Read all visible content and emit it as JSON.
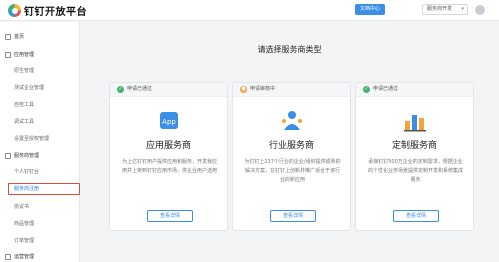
{
  "header": {
    "brand": "钉钉开放平台",
    "docs_button": "文档中心",
    "role_select": "服务商开发"
  },
  "sidebar": {
    "items": [
      {
        "label": "首页",
        "type": "group",
        "icon": "home-icon"
      },
      {
        "label": "应用管理",
        "type": "group",
        "icon": "app-icon"
      },
      {
        "label": "原生管理",
        "type": "sub"
      },
      {
        "label": "测试企业管理",
        "type": "sub"
      },
      {
        "label": "自检工具",
        "type": "sub"
      },
      {
        "label": "调试工具",
        "type": "sub"
      },
      {
        "label": "设置至授权管理",
        "type": "sub"
      },
      {
        "label": "服务商管理",
        "type": "group",
        "icon": "service-icon"
      },
      {
        "label": "个人钉钉台",
        "type": "sub"
      },
      {
        "label": "服务商注册",
        "type": "sub",
        "active": true
      },
      {
        "label": "协议书",
        "type": "sub"
      },
      {
        "label": "商品管理",
        "type": "sub"
      },
      {
        "label": "订单管理",
        "type": "sub"
      },
      {
        "label": "运营管理",
        "type": "group",
        "icon": "ops-icon"
      }
    ]
  },
  "main": {
    "title": "请选择服务商类型",
    "cards": [
      {
        "status": "申请已通过",
        "status_color": "#45b36b",
        "status_icon": "check-icon",
        "icon": "app-service-icon",
        "icon_text": "App",
        "title": "应用服务商",
        "desc": "为上亿钉钉用户提供应用和服务，开发我应用并上架到钉钉应用市场，供企业用户选用",
        "button": "查看详情"
      },
      {
        "status": "申请审核中",
        "status_color": "#f0a43a",
        "status_icon": "clock-icon",
        "icon": "industry-service-icon",
        "title": "行业服务商",
        "desc": "为钉钉上237个行业的企业/组织提供成熟的解决方案，在钉钉上创新并推广适合于该行业的新应用",
        "button": "查看详情"
      },
      {
        "status": "申请已通过",
        "status_color": "#45b36b",
        "status_icon": "check-icon",
        "icon": "custom-service-icon",
        "title": "定制服务商",
        "desc": "承接钉钉500万企业的定制需求，根据企业的个性化业务场景提供定制开发和系统集成服务",
        "button": "查看详情"
      }
    ]
  }
}
